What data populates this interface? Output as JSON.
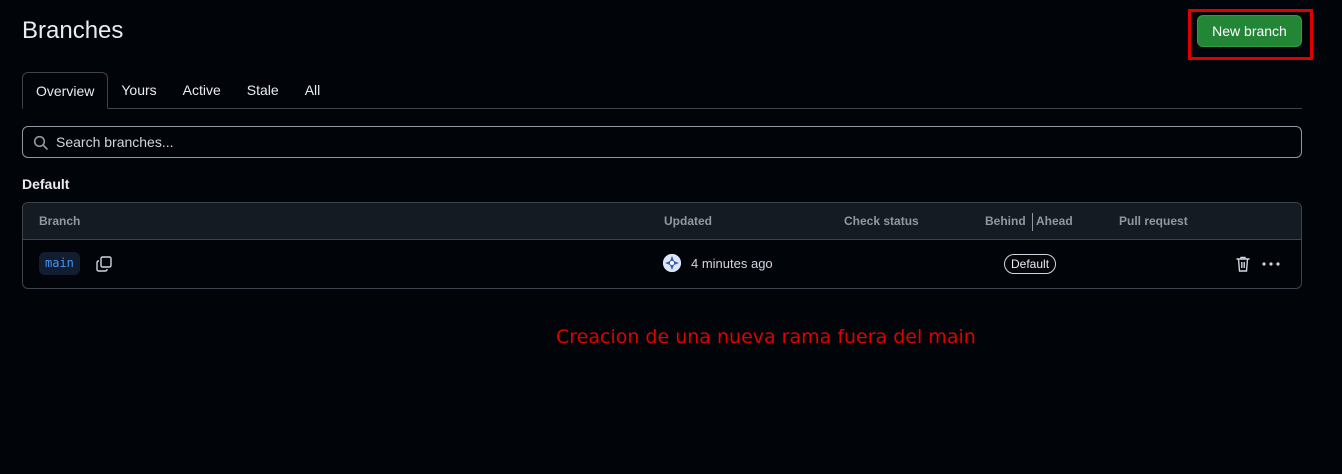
{
  "page": {
    "title": "Branches"
  },
  "toolbar": {
    "new_branch_label": "New branch"
  },
  "tabs": [
    {
      "label": "Overview",
      "active": true
    },
    {
      "label": "Yours",
      "active": false
    },
    {
      "label": "Active",
      "active": false
    },
    {
      "label": "Stale",
      "active": false
    },
    {
      "label": "All",
      "active": false
    }
  ],
  "search": {
    "placeholder": "Search branches..."
  },
  "section": {
    "label": "Default"
  },
  "table": {
    "headers": {
      "branch": "Branch",
      "updated": "Updated",
      "check_status": "Check status",
      "behind": "Behind",
      "ahead": "Ahead",
      "pull_request": "Pull request"
    },
    "rows": [
      {
        "branch": "main",
        "updated": "4 minutes ago",
        "badge": "Default",
        "icons": [
          "copy-icon",
          "avatar",
          "trash-icon",
          "kebab-icon"
        ]
      }
    ]
  },
  "annotation": {
    "text": "Creacion de una nueva rama fuera del main",
    "color": "#e00000"
  },
  "colors": {
    "background": "#010409",
    "primary_button": "#238636",
    "link": "#4493f8"
  }
}
